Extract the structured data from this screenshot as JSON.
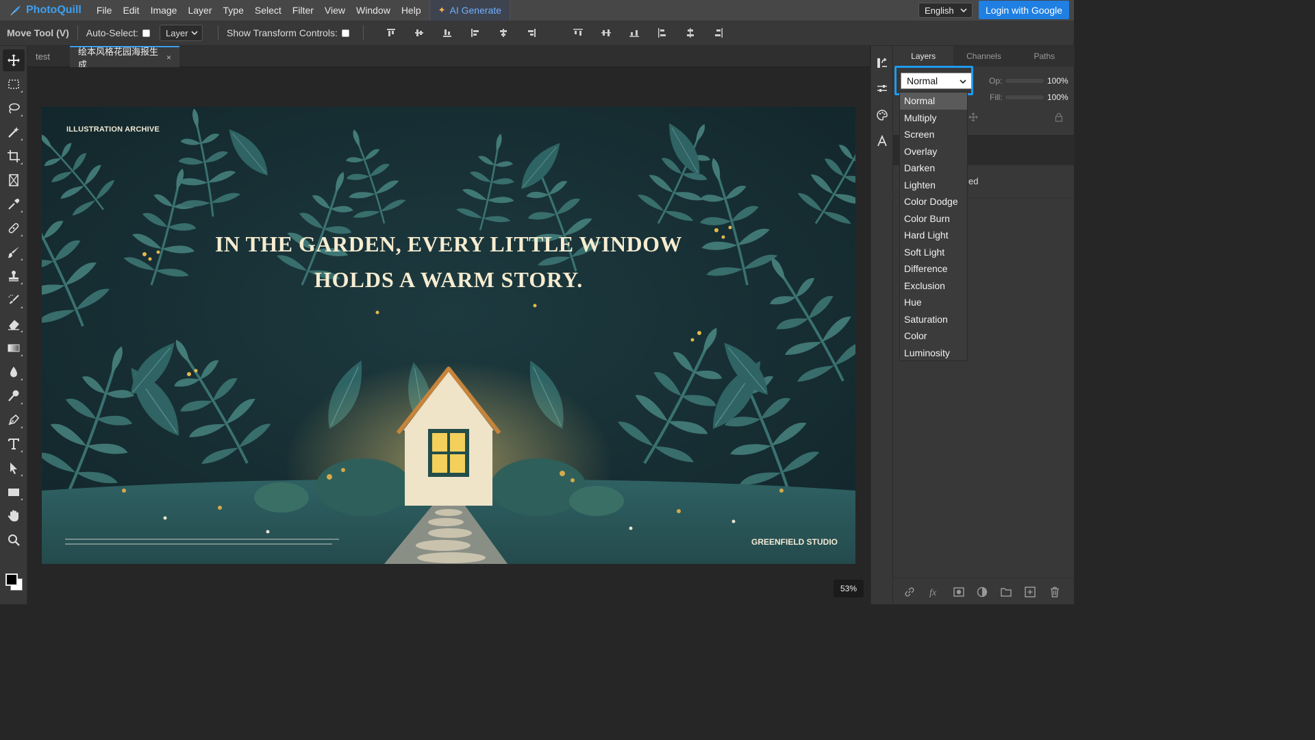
{
  "app": {
    "name": "PhotoQuill"
  },
  "menu": [
    "File",
    "Edit",
    "Image",
    "Layer",
    "Type",
    "Select",
    "Filter",
    "View",
    "Window",
    "Help"
  ],
  "ai_generate": {
    "label": "AI Generate",
    "icon": "sparkle-icon"
  },
  "language": {
    "value": "English"
  },
  "login": {
    "label": "Login with Google"
  },
  "options_bar": {
    "tool_name": "Move Tool (V)",
    "auto_select_label": "Auto-Select:",
    "auto_select_target": "Layer",
    "show_transform_label": "Show Transform Controls:"
  },
  "doc_tabs": [
    {
      "label": "test",
      "active": false
    },
    {
      "label": "绘本风格花园海报生成",
      "active": true,
      "close": "×"
    }
  ],
  "artwork": {
    "top_label": "ILLUSTRATION ARCHIVE",
    "headline_line1": "IN THE GARDEN, EVERY LITTLE WINDOW",
    "headline_line2": "HOLDS A WARM STORY.",
    "studio": "GREENFIELD STUDIO"
  },
  "zoom": "53%",
  "panel": {
    "tabs": [
      "Layers",
      "Channels",
      "Paths"
    ],
    "active_tab": "Layers",
    "blend_mode": "Normal",
    "opacity_label": "Op:",
    "opacity_value": "100%",
    "fill_label": "Fill:",
    "fill_value": "100%",
    "layer_partial": "ed"
  },
  "blend_options": [
    "Normal",
    "Multiply",
    "Screen",
    "Overlay",
    "Darken",
    "Lighten",
    "Color Dodge",
    "Color Burn",
    "Hard Light",
    "Soft Light",
    "Difference",
    "Exclusion",
    "Hue",
    "Saturation",
    "Color",
    "Luminosity"
  ],
  "colors": {
    "accent": "#1e9bf0",
    "brand": "#3da0f0",
    "login_bg": "#1f7fe3",
    "foreground_swatch": "#000000",
    "background_swatch": "#ffffff"
  },
  "tools": [
    "move-tool",
    "marquee-tool",
    "lasso-tool",
    "magic-wand-tool",
    "crop-tool",
    "frame-tool",
    "eyedropper-tool",
    "healing-tool",
    "brush-tool",
    "stamp-tool",
    "history-brush-tool",
    "eraser-tool",
    "gradient-tool",
    "blur-tool",
    "dodge-tool",
    "pen-tool",
    "type-tool",
    "path-select-tool",
    "shape-tool",
    "hand-tool",
    "zoom-tool"
  ]
}
